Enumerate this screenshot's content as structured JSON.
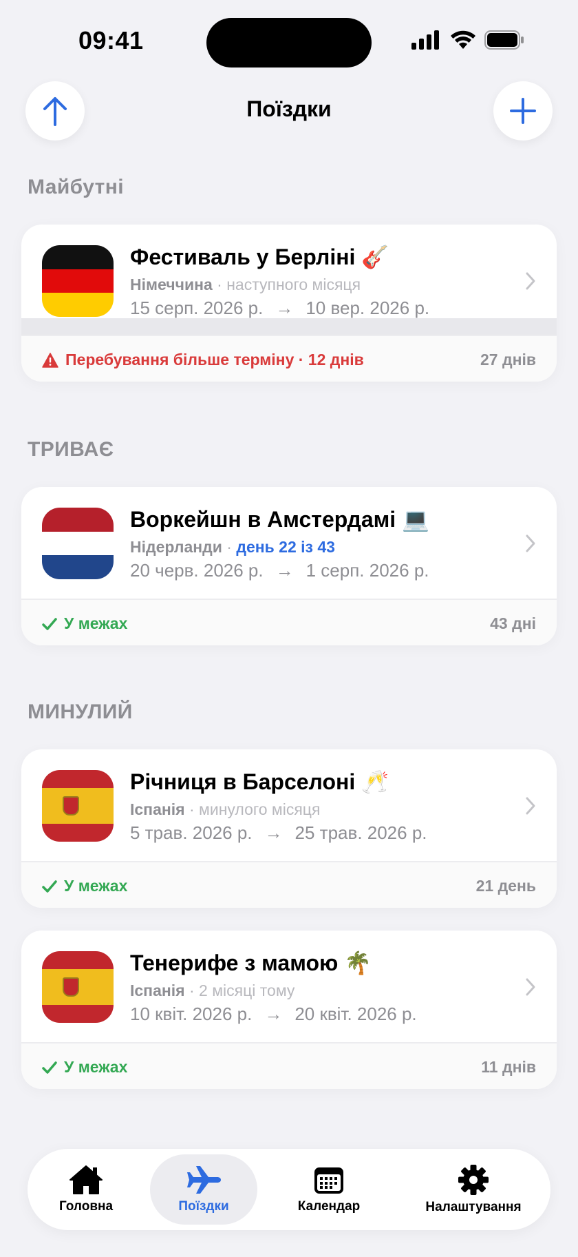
{
  "status_bar": {
    "time": "09:41"
  },
  "header": {
    "title": "Поїздки"
  },
  "sections": {
    "upcoming": "Майбутні",
    "ongoing": "ТРИВАЄ",
    "past": "МИНУЛИЙ"
  },
  "trips": [
    {
      "title": "Фестиваль у Берліні 🎸",
      "country": "Німеччина",
      "separator": "·",
      "relative": "наступного місяця",
      "start": "15 серп. 2026 р.",
      "arrow": "→",
      "end": "10 вер. 2026 р.",
      "status": "Перебування більше терміну · 12 днів",
      "days": "27 днів"
    },
    {
      "title": "Воркейшн в Амстердамі 💻",
      "country": "Нідерланди",
      "separator": "·",
      "relative": "день 22 із 43",
      "start": "20 черв. 2026 р.",
      "arrow": "→",
      "end": "1 серп. 2026 р.",
      "status": "У межах",
      "days": "43 дні"
    },
    {
      "title": "Річниця в Барселоні 🥂",
      "country": "Іспанія",
      "separator": "·",
      "relative": "минулого місяця",
      "start": "5 трав. 2026 р.",
      "arrow": "→",
      "end": "25 трав. 2026 р.",
      "status": "У межах",
      "days": "21 день"
    },
    {
      "title": "Тенерифе з мамою 🌴",
      "country": "Іспанія",
      "separator": "·",
      "relative": "2 місяці тому",
      "start": "10 квіт. 2026 р.",
      "arrow": "→",
      "end": "20 квіт. 2026 р.",
      "status": "У межах",
      "days": "11 днів"
    }
  ],
  "tabs": [
    {
      "label": "Головна",
      "icon": "house-icon"
    },
    {
      "label": "Поїздки",
      "icon": "airplane-icon"
    },
    {
      "label": "Календар",
      "icon": "calendar-icon"
    },
    {
      "label": "Налаштування",
      "icon": "gear-icon"
    }
  ],
  "colors": {
    "accent": "#2d6be0",
    "warning": "#d93a3a",
    "ok": "#33a853",
    "background": "#f2f2f6"
  }
}
